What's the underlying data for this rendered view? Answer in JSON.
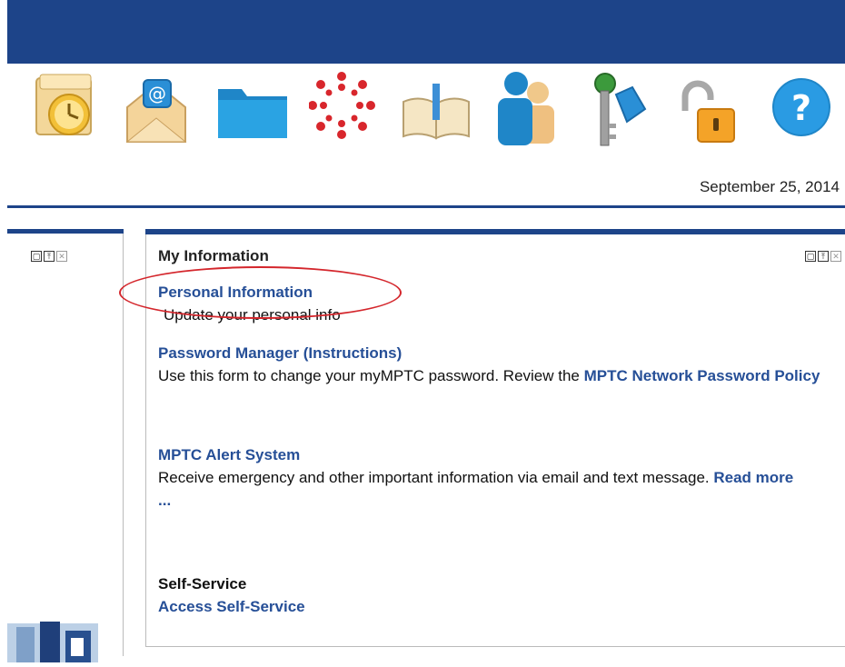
{
  "header": {
    "date": "September 25, 2014"
  },
  "toolbar": {
    "icons": [
      {
        "name": "outlook-calendar-icon"
      },
      {
        "name": "email-icon"
      },
      {
        "name": "folder-icon"
      },
      {
        "name": "canvas-icon"
      },
      {
        "name": "library-book-icon"
      },
      {
        "name": "directory-people-icon"
      },
      {
        "name": "keys-icon"
      },
      {
        "name": "unlock-icon"
      },
      {
        "name": "help-icon"
      }
    ],
    "help_glyph": "?"
  },
  "panel_controls": {
    "maximize": "▢",
    "minimize": "⤒",
    "close": "✕"
  },
  "my_information": {
    "title": "My Information",
    "personal": {
      "link": "Personal Information",
      "desc": "Update your personal info"
    },
    "password": {
      "link": "Password Manager",
      "instructions_link": "(Instructions)",
      "desc": "Use this form to change your myMPTC password. Review the",
      "policy_link": "MPTC Network Password Policy"
    },
    "alert": {
      "link": "MPTC Alert System",
      "desc": "Receive emergency and other important information via email and text message.",
      "read_more": "Read more ..."
    },
    "self_service": {
      "heading": "Self-Service",
      "link": "Access Self-Service"
    }
  },
  "colors": {
    "brand_blue": "#1d4489",
    "link_blue": "#264f97",
    "highlight_red": "#d4262c"
  }
}
